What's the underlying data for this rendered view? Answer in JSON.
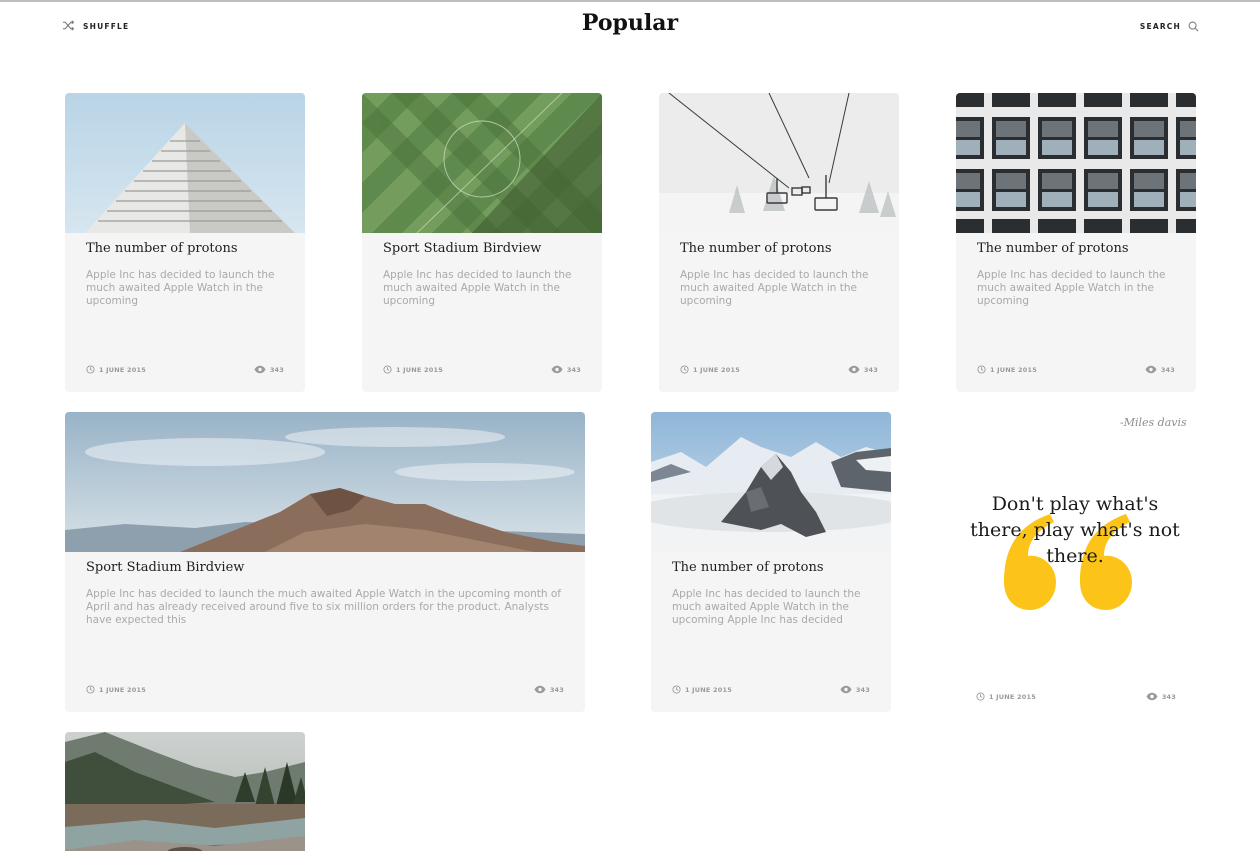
{
  "header": {
    "shuffle_label": "SHUFFLE",
    "title": "Popular",
    "search_label": "SEARCH"
  },
  "cards": [
    {
      "image": "pyramid-building-photo",
      "title": "The number of protons",
      "description": "Apple Inc has decided to launch the much awaited Apple Watch in the upcoming",
      "date": "1 JUNE 2015",
      "views": "343"
    },
    {
      "image": "stadium-aerial-photo",
      "title": "Sport Stadium Birdview",
      "description": "Apple Inc has decided to launch the much awaited Apple Watch in the upcoming",
      "date": "1 JUNE 2015",
      "views": "343"
    },
    {
      "image": "chairlift-fog-photo",
      "title": "The number of protons",
      "description": "Apple Inc has decided to launch the much awaited Apple Watch in the upcoming",
      "date": "1 JUNE 2015",
      "views": "343"
    },
    {
      "image": "building-windows-photo",
      "title": "The number of protons",
      "description": "Apple Inc has decided to launch the much awaited Apple Watch in the upcoming",
      "date": "1 JUNE 2015",
      "views": "343"
    },
    {
      "image": "mountain-ridge-photo",
      "title": "Sport Stadium Birdview",
      "description": "Apple Inc has decided to launch the much awaited Apple Watch in the upcoming month of April and has already received around five to six million orders for the product. Analysts have expected this",
      "date": "1 JUNE 2015",
      "views": "343"
    },
    {
      "image": "snowy-peaks-photo",
      "title": "The number of protons",
      "description": "Apple Inc has decided to launch the much awaited Apple Watch in the upcoming Apple Inc has decided",
      "date": "1 JUNE 2015",
      "views": "343"
    },
    {
      "image": "forest-river-photo"
    }
  ],
  "quote": {
    "author": "-Miles davis",
    "text": "Don't play what's there, play what's not there.",
    "date": "1 JUNE 2015",
    "views": "343",
    "accent_color": "#fcc419"
  },
  "icons": {
    "shuffle": "shuffle-icon",
    "search": "search-icon",
    "clock": "clock-icon",
    "eye": "eye-icon",
    "quote": "quote-mark-icon"
  }
}
